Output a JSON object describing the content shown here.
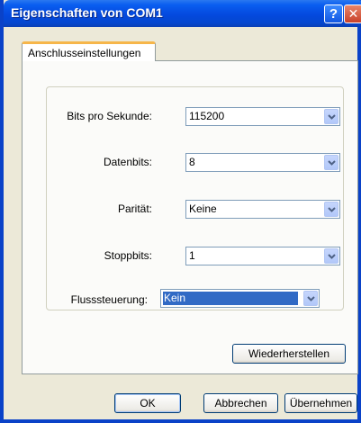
{
  "window": {
    "title": "Eigenschaften von COM1",
    "help_glyph": "?",
    "close_glyph": "✕"
  },
  "tabs": [
    {
      "label": "Anschlusseinstellungen",
      "selected": true
    }
  ],
  "fields": [
    {
      "label": "Bits pro Sekunde:",
      "value": "115200",
      "focused": false
    },
    {
      "label": "Datenbits:",
      "value": "8",
      "focused": false
    },
    {
      "label": "Parität:",
      "value": "Keine",
      "focused": false
    },
    {
      "label": "Stoppbits:",
      "value": "1",
      "focused": false
    },
    {
      "label": "Flusssteuerung:",
      "value": "Kein",
      "focused": true
    }
  ],
  "buttons": {
    "restore": "Wiederherstellen",
    "ok": "OK",
    "cancel": "Abbrechen",
    "apply": "Übernehmen"
  },
  "colors": {
    "titlebar": "#0a5ef0",
    "selection": "#316ac5",
    "tab_accent": "#f6b64a"
  },
  "icons": {
    "dropdown": "chevron-down-icon",
    "help": "help-icon",
    "close": "close-icon"
  }
}
